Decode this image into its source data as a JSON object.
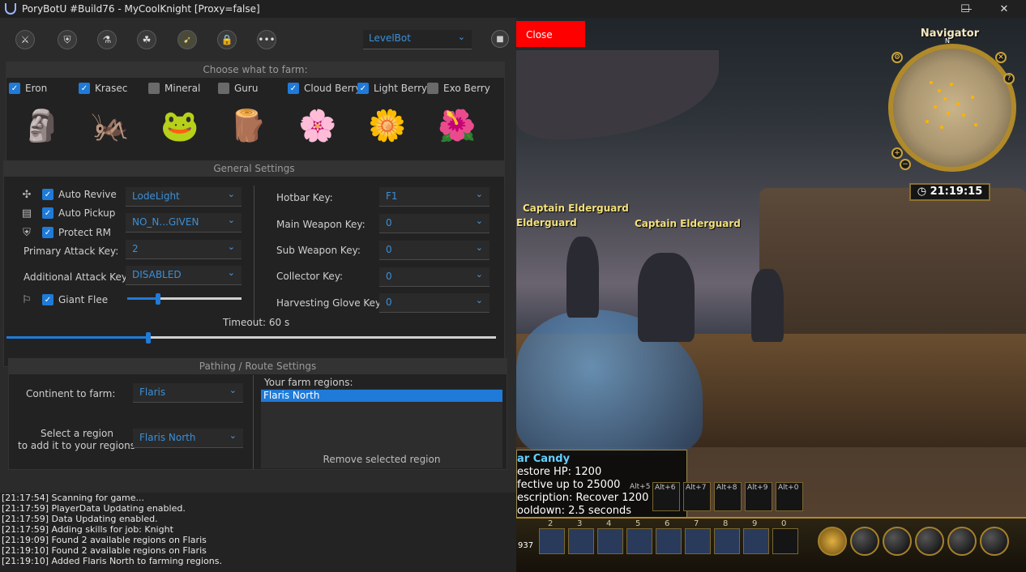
{
  "window": {
    "title": "PoryBotU #Build76 - MyCoolKnight  [Proxy=false]",
    "minimize_glyph": "—",
    "maximize_glyph": "☐",
    "close_glyph": "✕"
  },
  "toolbar": {
    "icons": [
      "sword-icon",
      "shield-icon",
      "potion-icon",
      "group-icon",
      "farm-icon",
      "lock-icon",
      "more-icon"
    ],
    "mode_select": "LevelBot",
    "chevron": "⌄"
  },
  "farm": {
    "header": "Choose what to farm:",
    "items": [
      {
        "label": "Eron",
        "checked": true,
        "glyph": "🗿"
      },
      {
        "label": "Krasec",
        "checked": true,
        "glyph": "🦗"
      },
      {
        "label": "Mineral",
        "checked": false,
        "glyph": "🐸"
      },
      {
        "label": "Guru",
        "checked": false,
        "glyph": "🪵"
      },
      {
        "label": "Cloud Berry",
        "checked": true,
        "glyph": "🌸"
      },
      {
        "label": "Light Berry",
        "checked": true,
        "glyph": "🌼"
      },
      {
        "label": "Exo Berry",
        "checked": false,
        "glyph": "🌺"
      }
    ]
  },
  "general": {
    "header": "General Settings",
    "auto_revive": "Auto Revive",
    "auto_pickup": "Auto Pickup",
    "protect_rm": "Protect RM",
    "primary_attack_key_label": "Primary Attack Key:",
    "additional_attack_key_label": "Additional Attack Key:",
    "giant_flee": "Giant Flee",
    "revive_value": "LodeLight",
    "pickup_value": "NO_N...GIVEN",
    "primary_attack_value": "2",
    "additional_attack_value": "DISABLED",
    "hotbar_key_label": "Hotbar Key:",
    "hotbar_key_value": "F1",
    "main_weapon_key_label": "Main Weapon Key:",
    "main_weapon_key_value": "0",
    "sub_weapon_key_label": "Sub Weapon Key:",
    "sub_weapon_key_value": "0",
    "collector_key_label": "Collector Key:",
    "collector_key_value": "0",
    "harvesting_glove_key_label": "Harvesting Glove Key:",
    "harvesting_glove_key_value": "0",
    "timeout_label": "Timeout: 60 s",
    "giant_flee_level": 0.27,
    "timeout_level": 0.29
  },
  "pathing": {
    "header": "Pathing / Route Settings",
    "continent_label": "Continent to farm:",
    "continent_value": "Flaris",
    "region_label_1": "Select a region",
    "region_label_2": "to add it to your regions",
    "region_value": "Flaris North",
    "regions_title": "Your farm regions:",
    "regions": [
      "Flaris North"
    ],
    "remove_button": "Remove selected region"
  },
  "log": [
    "[21:17:54] Scanning for game...",
    "[21:17:59] PlayerData Updating enabled.",
    "[21:17:59] Data Updating enabled.",
    "[21:17:59] Adding skills for job: Knight",
    "[21:19:09] Found 2 available regions on Flaris",
    "[21:19:10] Found 2 available regions on Flaris",
    "[21:19:10] Added Flaris North to farming regions."
  ],
  "game": {
    "close_button": "Close",
    "npc_names": [
      "Captain Elderguard",
      "Elderguard",
      "Captain Elderguard"
    ],
    "navigator": {
      "title": "Navigator",
      "compass": "N",
      "time": "21:19:15"
    },
    "tooltip": {
      "title": "ar Candy",
      "lines": [
        "estore HP: 1200",
        "fective up to 25000",
        "escription: Recover 1200 HP",
        "ooldown: 2.5 seconds"
      ]
    },
    "alt_slots": [
      "Alt+5",
      "Alt+6",
      "Alt+7",
      "Alt+8",
      "Alt+9",
      "Alt+0"
    ],
    "hotbar_slots": [
      "2",
      "3",
      "4",
      "5",
      "6",
      "7",
      "8",
      "9",
      "0"
    ],
    "hp_readout": "937"
  },
  "colors": {
    "accent": "#1f7ad8",
    "close_button": "#ff0000",
    "npc_name": "#f3e07a"
  }
}
